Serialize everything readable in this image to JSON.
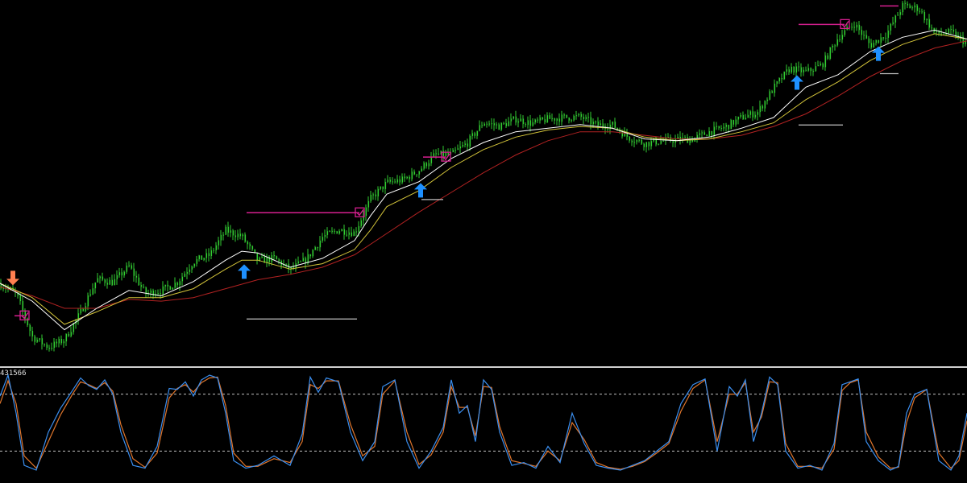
{
  "colors": {
    "background": "#000000",
    "candle": "#32cd32",
    "ma_fast": "#ffffff",
    "ma_mid": "#d4c53a",
    "ma_slow": "#b22222",
    "buy_arrow": "#1e90ff",
    "sell_arrow": "#ff7f50",
    "target_line": "#d61f8f",
    "stop_line": "#c0c0c0",
    "separator": "#d0d0d0",
    "stoch_main": "#3b8ff0",
    "stoch_signal": "#e0762c",
    "level_line": "#c0c0c0"
  },
  "oscillator": {
    "label": "431566",
    "levels": [
      80,
      20
    ]
  },
  "chart_data": [
    {
      "type": "candlestick",
      "title": "",
      "grid": false,
      "ylim": [
        0,
        100
      ],
      "series": [
        {
          "kind": "price",
          "x": [
            0,
            20,
            40,
            60,
            80,
            100,
            120,
            140,
            160,
            180,
            200,
            220,
            240,
            260,
            280,
            300,
            320,
            340,
            360,
            380,
            400,
            420,
            440,
            460,
            480,
            500,
            520,
            540,
            560,
            580,
            600,
            620,
            640,
            660,
            680,
            700,
            720,
            740,
            760,
            780,
            800,
            820,
            840,
            860,
            880,
            900,
            920,
            940,
            960,
            980,
            1000,
            1020,
            1040,
            1060,
            1080,
            1100,
            1120,
            1140,
            1160,
            1180,
            1200
          ],
          "y": [
            20.8,
            18.1,
            6.0,
            3.1,
            5.2,
            12.9,
            22.2,
            21.3,
            25.8,
            18.1,
            19.0,
            21.3,
            27.1,
            28.9,
            35.8,
            34.2,
            27.3,
            28.0,
            24.8,
            27.7,
            34.0,
            36.0,
            35.2,
            44.8,
            49.2,
            50.0,
            52.7,
            57.1,
            57.1,
            60.4,
            66.2,
            65.0,
            67.1,
            65.8,
            67.1,
            67.5,
            67.7,
            65.4,
            65.4,
            61.9,
            60.2,
            60.9,
            61.3,
            61.5,
            63.5,
            64.8,
            67.5,
            69.0,
            75.8,
            81.3,
            80.2,
            82.3,
            90.0,
            93.8,
            87.7,
            91.0,
            98.8,
            98.1,
            91.0,
            91.3,
            88.3
          ]
        },
        {
          "kind": "ma_fast",
          "name": "",
          "x": [
            0,
            40,
            80,
            120,
            160,
            200,
            240,
            280,
            300,
            320,
            360,
            400,
            440,
            460,
            480,
            520,
            560,
            600,
            640,
            680,
            720,
            760,
            800,
            840,
            880,
            920,
            960,
            1000,
            1040,
            1080,
            1120,
            1160,
            1200
          ],
          "y": [
            21.0,
            16.0,
            8.0,
            14.0,
            19.0,
            17.5,
            21.5,
            27.5,
            30.0,
            29.5,
            25.5,
            28.0,
            33.0,
            40.0,
            46.0,
            49.5,
            56.0,
            60.5,
            63.5,
            64.5,
            65.5,
            64.5,
            61.5,
            61.0,
            62.0,
            64.5,
            67.5,
            76.0,
            79.5,
            86.0,
            90.0,
            92.0,
            89.5
          ]
        },
        {
          "kind": "ma_mid",
          "name": "",
          "x": [
            0,
            40,
            80,
            120,
            160,
            200,
            240,
            280,
            300,
            320,
            360,
            400,
            440,
            460,
            480,
            520,
            560,
            600,
            640,
            680,
            720,
            760,
            800,
            840,
            880,
            920,
            960,
            1000,
            1040,
            1080,
            1120,
            1160,
            1200
          ],
          "y": [
            21.0,
            17.0,
            9.5,
            13.0,
            17.0,
            17.0,
            19.5,
            25.0,
            27.5,
            27.5,
            25.0,
            26.5,
            30.5,
            36.0,
            42.5,
            47.0,
            53.5,
            58.5,
            62.0,
            64.0,
            65.0,
            64.5,
            62.0,
            61.0,
            61.5,
            63.5,
            66.0,
            72.5,
            77.5,
            83.5,
            88.0,
            91.0,
            89.5
          ]
        },
        {
          "kind": "ma_slow",
          "name": "",
          "x": [
            0,
            40,
            80,
            120,
            160,
            200,
            240,
            280,
            320,
            360,
            400,
            440,
            480,
            520,
            560,
            600,
            640,
            680,
            720,
            760,
            800,
            840,
            880,
            920,
            960,
            1000,
            1040,
            1080,
            1120,
            1160,
            1200
          ],
          "y": [
            20.0,
            17.5,
            14.0,
            14.0,
            16.5,
            16.0,
            17.0,
            19.5,
            22.0,
            23.5,
            25.5,
            29.0,
            35.0,
            41.0,
            46.5,
            52.0,
            57.0,
            61.0,
            63.5,
            63.5,
            62.5,
            61.5,
            61.5,
            62.5,
            65.0,
            68.5,
            73.5,
            79.0,
            83.5,
            87.0,
            89.0
          ]
        }
      ],
      "signals": [
        {
          "type": "sell",
          "x": 16,
          "y": 22.5
        },
        {
          "type": "buy",
          "x": 303,
          "y": 24.3
        },
        {
          "type": "buy",
          "x": 522,
          "y": 47.1
        },
        {
          "type": "buy",
          "x": 989,
          "y": 77.3
        },
        {
          "type": "buy",
          "x": 1090,
          "y": 85.4
        }
      ],
      "target_lines": [
        {
          "x1": 18,
          "x2": 30,
          "y": 11.9,
          "check": true
        },
        {
          "x1": 306,
          "x2": 446,
          "y": 40.8,
          "check": true
        },
        {
          "x1": 525,
          "x2": 553,
          "y": 56.4,
          "check": true
        },
        {
          "x1": 991,
          "x2": 1048,
          "y": 93.6,
          "check": true
        },
        {
          "x1": 1092,
          "x2": 1115,
          "y": 98.8,
          "check": false
        }
      ],
      "stop_lines": [
        {
          "x1": 306,
          "x2": 443,
          "y": 11.0
        },
        {
          "x1": 523,
          "x2": 550,
          "y": 44.5
        },
        {
          "x1": 991,
          "x2": 1046,
          "y": 65.4
        },
        {
          "x1": 1092,
          "x2": 1115,
          "y": 79.8
        }
      ]
    },
    {
      "type": "line",
      "title": "",
      "grid": false,
      "ylim": [
        0,
        100
      ],
      "series": [
        {
          "kind": "stoch_main",
          "name": "",
          "x": [
            0,
            10,
            20,
            30,
            45,
            60,
            75,
            90,
            100,
            110,
            120,
            130,
            140,
            150,
            165,
            180,
            195,
            210,
            220,
            230,
            240,
            250,
            260,
            270,
            280,
            290,
            305,
            320,
            340,
            360,
            375,
            385,
            395,
            405,
            420,
            435,
            450,
            465,
            475,
            490,
            505,
            520,
            535,
            550,
            560,
            570,
            580,
            590,
            600,
            610,
            620,
            635,
            650,
            665,
            680,
            695,
            710,
            725,
            740,
            755,
            770,
            785,
            800,
            815,
            830,
            845,
            860,
            875,
            890,
            905,
            915,
            925,
            935,
            945,
            955,
            965,
            975,
            990,
            1005,
            1020,
            1035,
            1045,
            1055,
            1065,
            1075,
            1090,
            1105,
            1115,
            1125,
            1135,
            1150,
            1165,
            1180,
            1190,
            1200
          ],
          "y": [
            78,
            100,
            60,
            5,
            0,
            40,
            65,
            84,
            97,
            89,
            85,
            95,
            80,
            40,
            5,
            2,
            25,
            86,
            85,
            93,
            78,
            95,
            100,
            97,
            60,
            10,
            2,
            5,
            15,
            5,
            38,
            98,
            82,
            97,
            93,
            40,
            10,
            30,
            88,
            95,
            30,
            2,
            20,
            45,
            95,
            60,
            68,
            30,
            95,
            85,
            40,
            5,
            8,
            2,
            25,
            8,
            60,
            28,
            5,
            2,
            0,
            5,
            10,
            20,
            30,
            70,
            90,
            96,
            20,
            88,
            78,
            95,
            30,
            60,
            98,
            90,
            20,
            2,
            5,
            0,
            28,
            90,
            93,
            96,
            30,
            10,
            0,
            4,
            60,
            80,
            85,
            10,
            0,
            15,
            60
          ]
        },
        {
          "kind": "stoch_signal",
          "name": "",
          "x": [
            0,
            10,
            20,
            30,
            45,
            60,
            75,
            90,
            100,
            110,
            120,
            130,
            140,
            150,
            165,
            180,
            195,
            210,
            220,
            230,
            240,
            250,
            260,
            270,
            280,
            290,
            305,
            320,
            340,
            360,
            375,
            385,
            395,
            405,
            420,
            435,
            450,
            465,
            475,
            490,
            505,
            520,
            535,
            550,
            560,
            570,
            580,
            590,
            600,
            610,
            620,
            635,
            650,
            665,
            680,
            695,
            710,
            725,
            740,
            755,
            770,
            785,
            800,
            815,
            830,
            845,
            860,
            875,
            890,
            905,
            915,
            925,
            935,
            945,
            955,
            965,
            975,
            990,
            1005,
            1020,
            1035,
            1045,
            1055,
            1065,
            1075,
            1090,
            1105,
            1115,
            1125,
            1135,
            1150,
            1165,
            1180,
            1190,
            1200
          ],
          "y": [
            70,
            94,
            70,
            15,
            2,
            30,
            58,
            80,
            93,
            90,
            86,
            92,
            83,
            48,
            12,
            3,
            18,
            76,
            86,
            90,
            82,
            92,
            97,
            98,
            68,
            18,
            4,
            4,
            12,
            8,
            30,
            90,
            86,
            94,
            94,
            48,
            15,
            25,
            80,
            94,
            40,
            6,
            16,
            40,
            88,
            66,
            66,
            36,
            88,
            87,
            46,
            10,
            7,
            4,
            20,
            10,
            50,
            32,
            8,
            3,
            1,
            4,
            9,
            18,
            28,
            62,
            86,
            95,
            30,
            80,
            80,
            92,
            40,
            56,
            93,
            92,
            28,
            4,
            4,
            2,
            22,
            84,
            92,
            95,
            40,
            14,
            2,
            3,
            50,
            76,
            85,
            18,
            2,
            10,
            52
          ]
        }
      ]
    }
  ]
}
